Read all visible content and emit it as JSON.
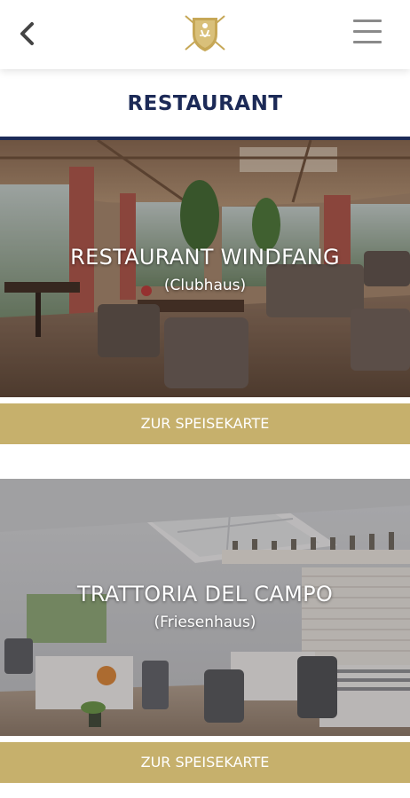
{
  "header": {
    "back_icon": "chevron-left-icon",
    "logo_icon": "golf-club-crest-logo",
    "menu_icon": "hamburger-menu-icon"
  },
  "page": {
    "title": "RESTAURANT"
  },
  "restaurants": [
    {
      "name": "RESTAURANT WINDFANG",
      "location": "(Clubhaus)",
      "button_label": "ZUR SPEISEKARTE"
    },
    {
      "name": "TRATTORIA DEL CAMPO",
      "location": "(Friesenhaus)",
      "button_label": "ZUR SPEISEKARTE"
    }
  ],
  "colors": {
    "navy": "#1c2a57",
    "gold": "#c6b06c",
    "icon_grey": "#8a8a8a"
  }
}
